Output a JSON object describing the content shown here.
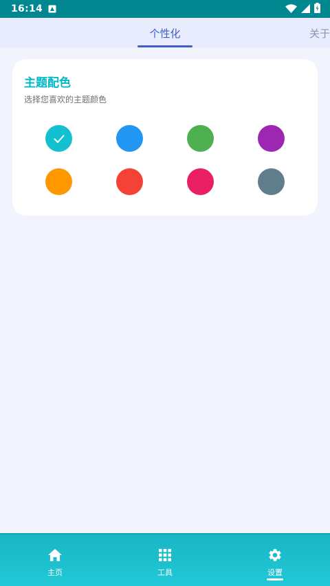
{
  "status_bar": {
    "time": "16:14"
  },
  "tabs": [
    {
      "label": "个性化",
      "active": true
    },
    {
      "label": "关于",
      "active": false
    }
  ],
  "theme_card": {
    "title": "主题配色",
    "subtitle": "选择您喜欢的主题颜色",
    "colors": [
      {
        "color": "#13c0d0",
        "selected": true
      },
      {
        "color": "#2196f3",
        "selected": false
      },
      {
        "color": "#4caf50",
        "selected": false
      },
      {
        "color": "#9c27b0",
        "selected": false
      },
      {
        "color": "#ff9800",
        "selected": false
      },
      {
        "color": "#f44336",
        "selected": false
      },
      {
        "color": "#e91e63",
        "selected": false
      },
      {
        "color": "#607d8b",
        "selected": false
      }
    ]
  },
  "bottom_nav": {
    "items": [
      {
        "label": "主页",
        "icon": "home-icon"
      },
      {
        "label": "工具",
        "icon": "grid-icon"
      },
      {
        "label": "设置",
        "icon": "settings-icon",
        "active": true
      }
    ]
  }
}
